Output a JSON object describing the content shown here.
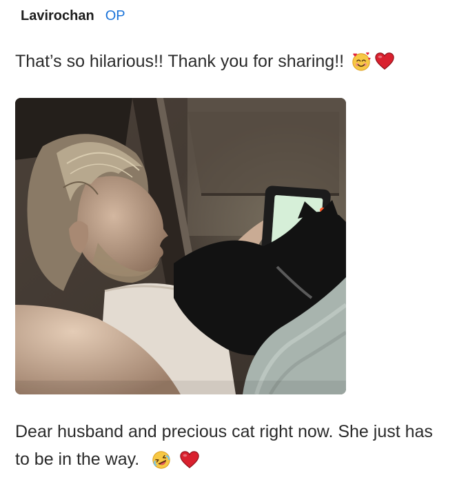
{
  "comment": {
    "author": "Lavirochan",
    "badge": "OP",
    "text_first": "That’s so hilarious!! Thank you for sharing!!",
    "text_first_emojis": [
      "smiling-face-with-hearts-icon",
      "red-heart-icon"
    ],
    "text_second": "Dear husband and precious cat right now. She just has to be in the way.",
    "text_second_emojis": [
      "rolling-on-floor-laughing-icon",
      "red-heart-icon"
    ]
  },
  "colors": {
    "author": "#1c1c1c",
    "badge": "#1a73d9",
    "body_text": "#2a2a2a",
    "heart": "#d9202e",
    "emoji_face": "#f7c844"
  }
}
